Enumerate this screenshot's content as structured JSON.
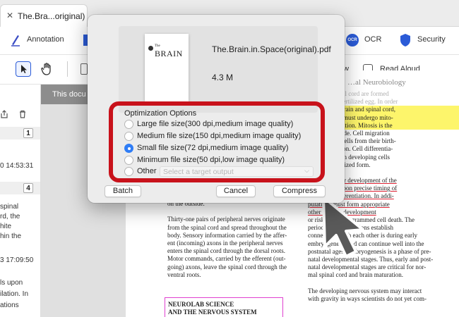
{
  "tab": {
    "close": "✕",
    "title": "The.Bra...original)"
  },
  "toolbar": {
    "annotation": "Annotation",
    "ocr": "OCR",
    "ocr_badge": "OCR",
    "security": "Security"
  },
  "subbar": {
    "partial_view": "w",
    "read_aloud": "Read Aloud"
  },
  "sidebar": {
    "row1_num": "1",
    "row1_time": "0 14:53:31",
    "row2_num": "4",
    "row2_text": [
      "spinal",
      "rd, the",
      "hite",
      "hin the"
    ],
    "row2_time": "3 17:09:50",
    "row3_text": [
      "ls upon",
      "ilation. In",
      "ations"
    ]
  },
  "doc": {
    "strip_text": "This docu",
    "right_col": [
      "…in and spinal cord are formed",
      "…ells in the fertilized egg. In order",
      "y developed brain and spinal cord,",
      "fertilized egg must undergo mito-",
      "and differentiation. Mitosis is the",
      "hich cells divide. Cell migration",
      "novement of cells from their birth-",
      "final destination. Cell differentia-",
      "ocess by which developing cells",
      "ir final specialized form.",
      "",
      "eve that proper development of the",
      "em depends upon precise timing of",
      "ation, and differentiation. In addi-",
      "pulations must form appropriate",
      "other early in development",
      "or risk losing programmed cell death. The",
      "period … al populations establish",
      "connections with each other is during early",
      "embryogenesis and can continue well into the",
      "postnatal ages. Embryogenesis is a phase of pre-",
      "natal developmental stages. Thus, early and post-",
      "natal developmental stages are critical for nor-",
      "mal spinal cord and brain maturation.",
      "",
      "The developing nervous system may interact",
      "with gravity in ways scientists do not yet com-"
    ],
    "left_col": [
      "on the outside.",
      "",
      "Thirty-one pairs of peripheral nerves originate",
      "from the spinal cord and spread throughout the",
      "body. Sensory information carried by the affer-",
      "ent (incoming) axons in the peripheral nerves",
      "enters the spinal cord through the dorsal roots.",
      "Motor commands, carried by the efferent (out-",
      "going) axons, leave the spinal cord through the",
      "ventral roots."
    ],
    "box_line1": "NEUROLAB SCIENCE",
    "box_line2": "AND THE NERVOUS SYSTEM",
    "heading_partial": "…al Neurobiology"
  },
  "dialog": {
    "thumb_the": "The",
    "thumb_brain": "BRAIN",
    "file_name": "The.Brain.in.Space(original).pdf",
    "file_size": "4.3 M",
    "options_title": "Optimization Options",
    "options": [
      {
        "label": "Large file size(300 dpi,medium image quality)",
        "selected": false
      },
      {
        "label": "Medium file size(150 dpi,medium image quality)",
        "selected": false
      },
      {
        "label": "Small file size(72 dpi,medium image quality)",
        "selected": true
      },
      {
        "label": "Minimum file size(50 dpi,low image quality)",
        "selected": false
      },
      {
        "label": "Other",
        "selected": false
      }
    ],
    "other_placeholder": "Select a target output",
    "batch": "Batch",
    "cancel": "Cancel",
    "compress": "Compress"
  },
  "colors": {
    "accent": "#2f7df6",
    "highlight_box": "#c8121b",
    "text_highlight": "#fdf56b"
  }
}
